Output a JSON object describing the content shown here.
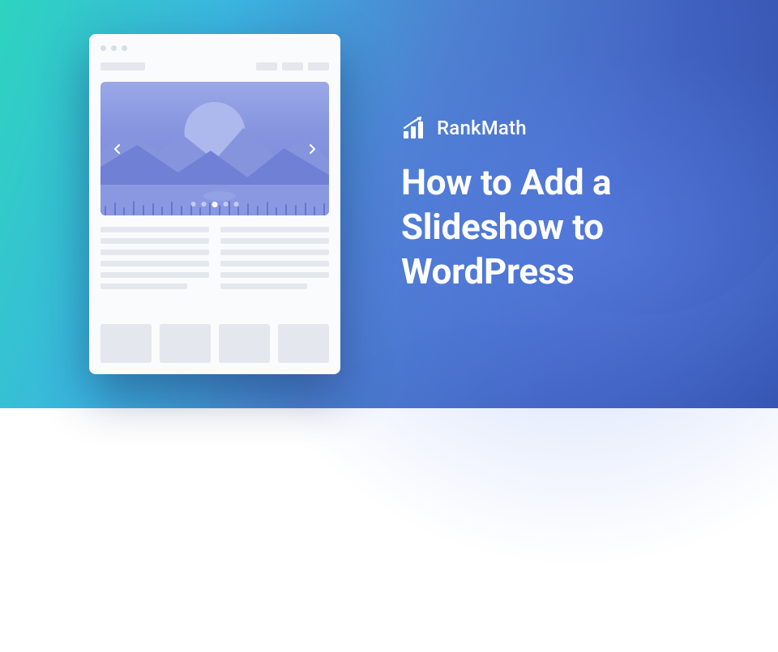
{
  "brand": {
    "name": "RankMath"
  },
  "title": "How to Add a Slideshow to WordPress",
  "slideshow": {
    "dot_count": 5,
    "active_dot": 3
  }
}
